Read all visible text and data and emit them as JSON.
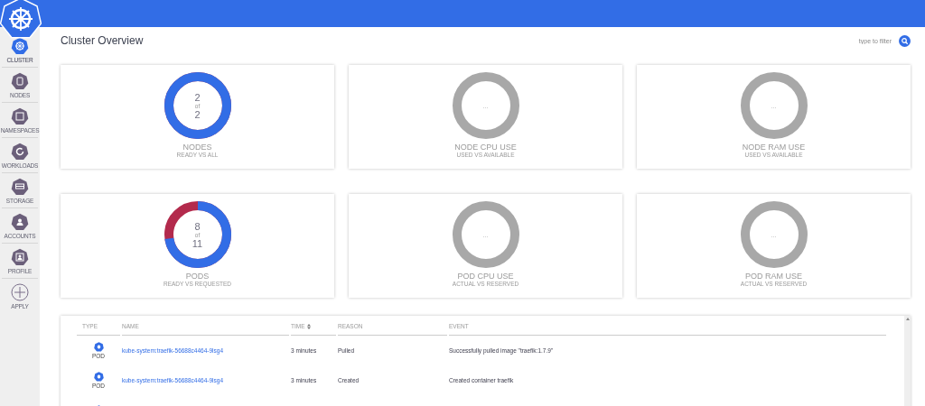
{
  "sidebar": {
    "items": [
      {
        "label": "CLUSTER",
        "selected": true
      },
      {
        "label": "NODES",
        "selected": false
      },
      {
        "label": "NAMESPACES",
        "selected": false
      },
      {
        "label": "WORKLOADS",
        "selected": false
      },
      {
        "label": "STORAGE",
        "selected": false
      },
      {
        "label": "ACCOUNTS",
        "selected": false
      },
      {
        "label": "PROFILE",
        "selected": false
      },
      {
        "label": "APPLY",
        "selected": false,
        "kind": "add"
      }
    ]
  },
  "page": {
    "title": "Cluster Overview",
    "filter": {
      "placeholder": "type to filter"
    }
  },
  "cards": [
    {
      "kind": "ratio",
      "level": 1,
      "value": "2",
      "of": "of",
      "total": "2",
      "title": "NODES",
      "subtitle": "READY VS ALL"
    },
    {
      "kind": "pending",
      "center": "...",
      "title": "NODE CPU USE",
      "subtitle": "USED VS AVAILABLE"
    },
    {
      "kind": "pending",
      "center": "...",
      "title": "NODE RAM USE",
      "subtitle": "USED VS AVAILABLE"
    },
    {
      "kind": "ratio",
      "level": 0.727,
      "value": "8",
      "of": "of",
      "total": "11",
      "title": "PODS",
      "subtitle": "READY VS REQUESTED"
    },
    {
      "kind": "pending",
      "center": "...",
      "title": "POD CPU USE",
      "subtitle": "ACTUAL VS RESERVED"
    },
    {
      "kind": "pending",
      "center": "...",
      "title": "POD RAM USE",
      "subtitle": "ACTUAL VS RESERVED"
    }
  ],
  "events": {
    "columns": [
      "TYPE",
      "NAME",
      "TIME",
      "REASON",
      "EVENT"
    ],
    "rows": [
      {
        "kind": "event",
        "type": "POD",
        "name": "kube-system:traefik-56688c4464-9lsg4",
        "time": "3 minutes",
        "reason": "Pulled",
        "event": "Successfully pulled image \"traefik:1.7.9\""
      },
      {
        "kind": "event",
        "type": "POD",
        "name": "kube-system:traefik-56688c4464-9lsg4",
        "time": "3 minutes",
        "reason": "Created",
        "event": "Created container traefik"
      },
      {
        "kind": "partial"
      }
    ]
  }
}
